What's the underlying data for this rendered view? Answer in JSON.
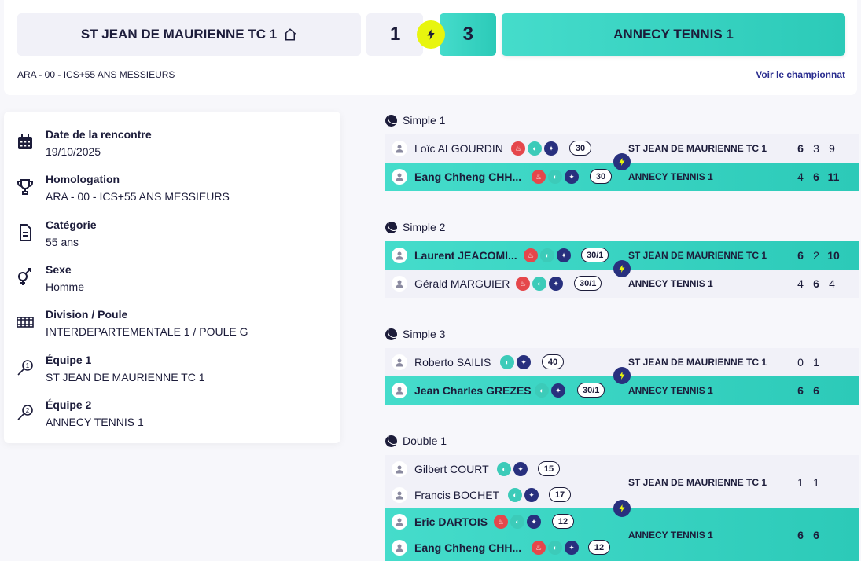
{
  "header": {
    "team1": "ST JEAN DE MAURIENNE TC 1",
    "team2": "ANNECY TENNIS 1",
    "score1": "1",
    "score2": "3",
    "homologation": "ARA - 00 - ICS+55 ANS MESSIEURS",
    "link": "Voir le championnat"
  },
  "info": [
    {
      "label": "Date de la rencontre",
      "value": "19/10/2025",
      "icon": "calendar-icon"
    },
    {
      "label": "Homologation",
      "value": "ARA - 00 - ICS+55 ANS MESSIEURS",
      "icon": "trophy-icon"
    },
    {
      "label": "Catégorie",
      "value": "55 ans",
      "icon": "document-icon"
    },
    {
      "label": "Sexe",
      "value": "Homme",
      "icon": "gender-icon"
    },
    {
      "label": "Division / Poule",
      "value": "INTERDEPARTEMENTALE 1 / POULE G",
      "icon": "grid-icon"
    },
    {
      "label": "Équipe 1",
      "value": "ST JEAN DE MAURIENNE TC 1",
      "icon": "racket-1-icon"
    },
    {
      "label": "Équipe 2",
      "value": "ANNECY TENNIS 1",
      "icon": "racket-2-icon"
    }
  ],
  "matches": [
    {
      "title": "Simple 1",
      "team1_label": "ST JEAN DE MAURIENNE TC 1",
      "team2_label": "ANNECY TENNIS 1",
      "p1": [
        {
          "name": "Loïc ALGOURDIN",
          "rank": "30"
        }
      ],
      "p2": [
        {
          "name": "Eang Chheng CHH...",
          "rank": "30"
        }
      ],
      "sets1": [
        "6",
        "3",
        "9"
      ],
      "sets2": [
        "4",
        "6",
        "11"
      ]
    },
    {
      "title": "Simple 2",
      "team1_label": "ST JEAN DE MAURIENNE TC 1",
      "team2_label": "ANNECY TENNIS 1",
      "p1": [
        {
          "name": "Laurent JEACOMI...",
          "rank": "30/1"
        }
      ],
      "p2": [
        {
          "name": "Gérald MARGUIER",
          "rank": "30/1"
        }
      ],
      "sets1": [
        "6",
        "2",
        "10"
      ],
      "sets2": [
        "4",
        "6",
        "4"
      ]
    },
    {
      "title": "Simple 3",
      "team1_label": "ST JEAN DE MAURIENNE TC 1",
      "team2_label": "ANNECY TENNIS 1",
      "p1": [
        {
          "name": "Roberto SAILIS",
          "rank": "40"
        }
      ],
      "p2": [
        {
          "name": "Jean Charles GREZES",
          "rank": "30/1"
        }
      ],
      "sets1": [
        "0",
        "1"
      ],
      "sets2": [
        "6",
        "6"
      ]
    },
    {
      "title": "Double 1",
      "team1_label": "ST JEAN DE MAURIENNE TC 1",
      "team2_label": "ANNECY TENNIS 1",
      "p1": [
        {
          "name": "Gilbert COURT",
          "rank": "15"
        },
        {
          "name": "Francis BOCHET",
          "rank": "17"
        }
      ],
      "p2": [
        {
          "name": "Eric DARTOIS",
          "rank": "12"
        },
        {
          "name": "Eang Chheng CHH...",
          "rank": "12"
        }
      ],
      "sets1": [
        "1",
        "1"
      ],
      "sets2": [
        "6",
        "6"
      ]
    }
  ],
  "colors": {
    "accent": "#45dccb",
    "navy": "#28307e",
    "bolt": "#e8f50e",
    "red": "#e5474b"
  }
}
